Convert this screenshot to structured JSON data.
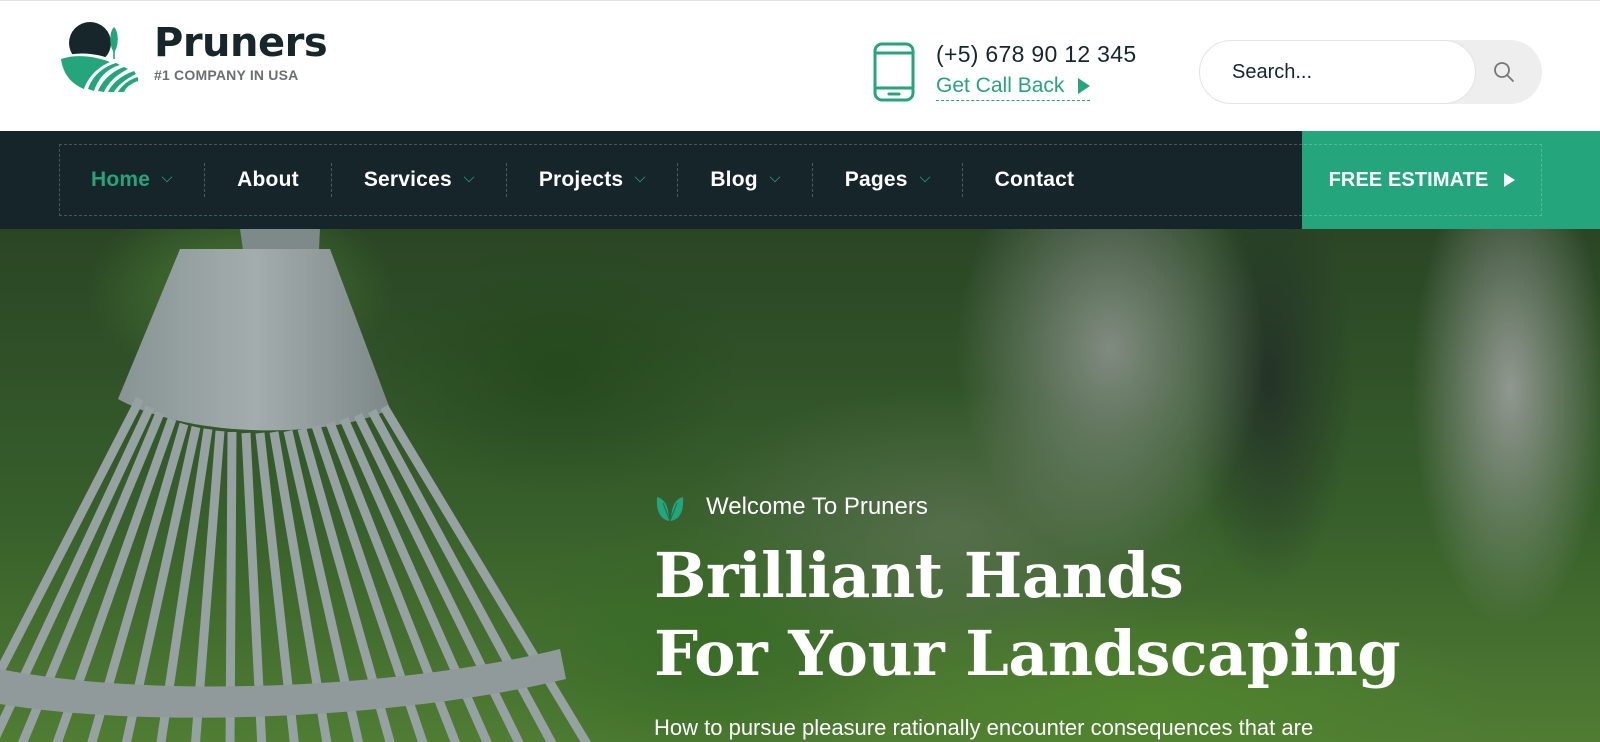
{
  "header": {
    "logo": {
      "name": "Pruners",
      "tagline": "#1 COMPANY IN USA"
    },
    "contact": {
      "phone": "(+5) 678 90 12 345",
      "callback_label": "Get Call Back"
    },
    "search": {
      "placeholder": "Search..."
    }
  },
  "nav": {
    "items": [
      {
        "label": "Home",
        "dropdown": true,
        "active": true
      },
      {
        "label": "About",
        "dropdown": false
      },
      {
        "label": "Services",
        "dropdown": true
      },
      {
        "label": "Projects",
        "dropdown": true
      },
      {
        "label": "Blog",
        "dropdown": true
      },
      {
        "label": "Pages",
        "dropdown": true
      },
      {
        "label": "Contact",
        "dropdown": false
      }
    ],
    "cta_label": "FREE ESTIMATE"
  },
  "hero": {
    "eyebrow": "Welcome To Pruners",
    "title_line1": "Brilliant Hands",
    "title_line2": "For Your Landscaping",
    "description": "How to pursue pleasure rationally encounter consequences that are"
  },
  "colors": {
    "accent": "#25a57b",
    "dark": "#16252a",
    "text": "#16262a"
  }
}
